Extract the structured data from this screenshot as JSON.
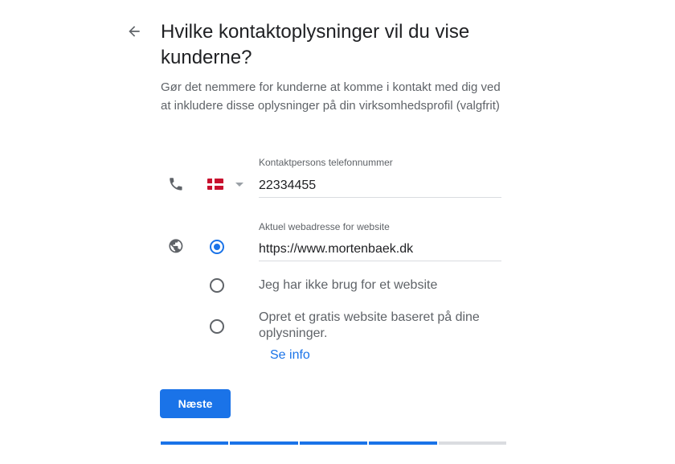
{
  "header": {
    "title": "Hvilke kontaktoplysninger vil du vise kunderne?",
    "subtitle": "Gør det nemmere for kunderne at komme i kontakt med dig ved at inkludere disse oplysninger på din virksomhedsprofil (valgfrit)"
  },
  "phone": {
    "country_flag": "denmark-flag",
    "label": "Kontaktpersons telefonnummer",
    "value": "22334455"
  },
  "website": {
    "label": "Aktuel webadresse for website",
    "value": "https://www.mortenbaek.dk",
    "selected_option": "website-url",
    "options": [
      {
        "label": "Jeg har ikke brug for et website"
      },
      {
        "label": "Opret et gratis website baseret på dine oplysninger."
      }
    ],
    "info_link": "Se info"
  },
  "actions": {
    "next_label": "Næste"
  },
  "progress": {
    "completed_steps": 4,
    "total_steps": 5
  },
  "colors": {
    "accent": "#1a73e8",
    "text_primary": "#202124",
    "text_secondary": "#5f6368",
    "divider": "#dadce0",
    "flag_red": "#c8102e"
  }
}
